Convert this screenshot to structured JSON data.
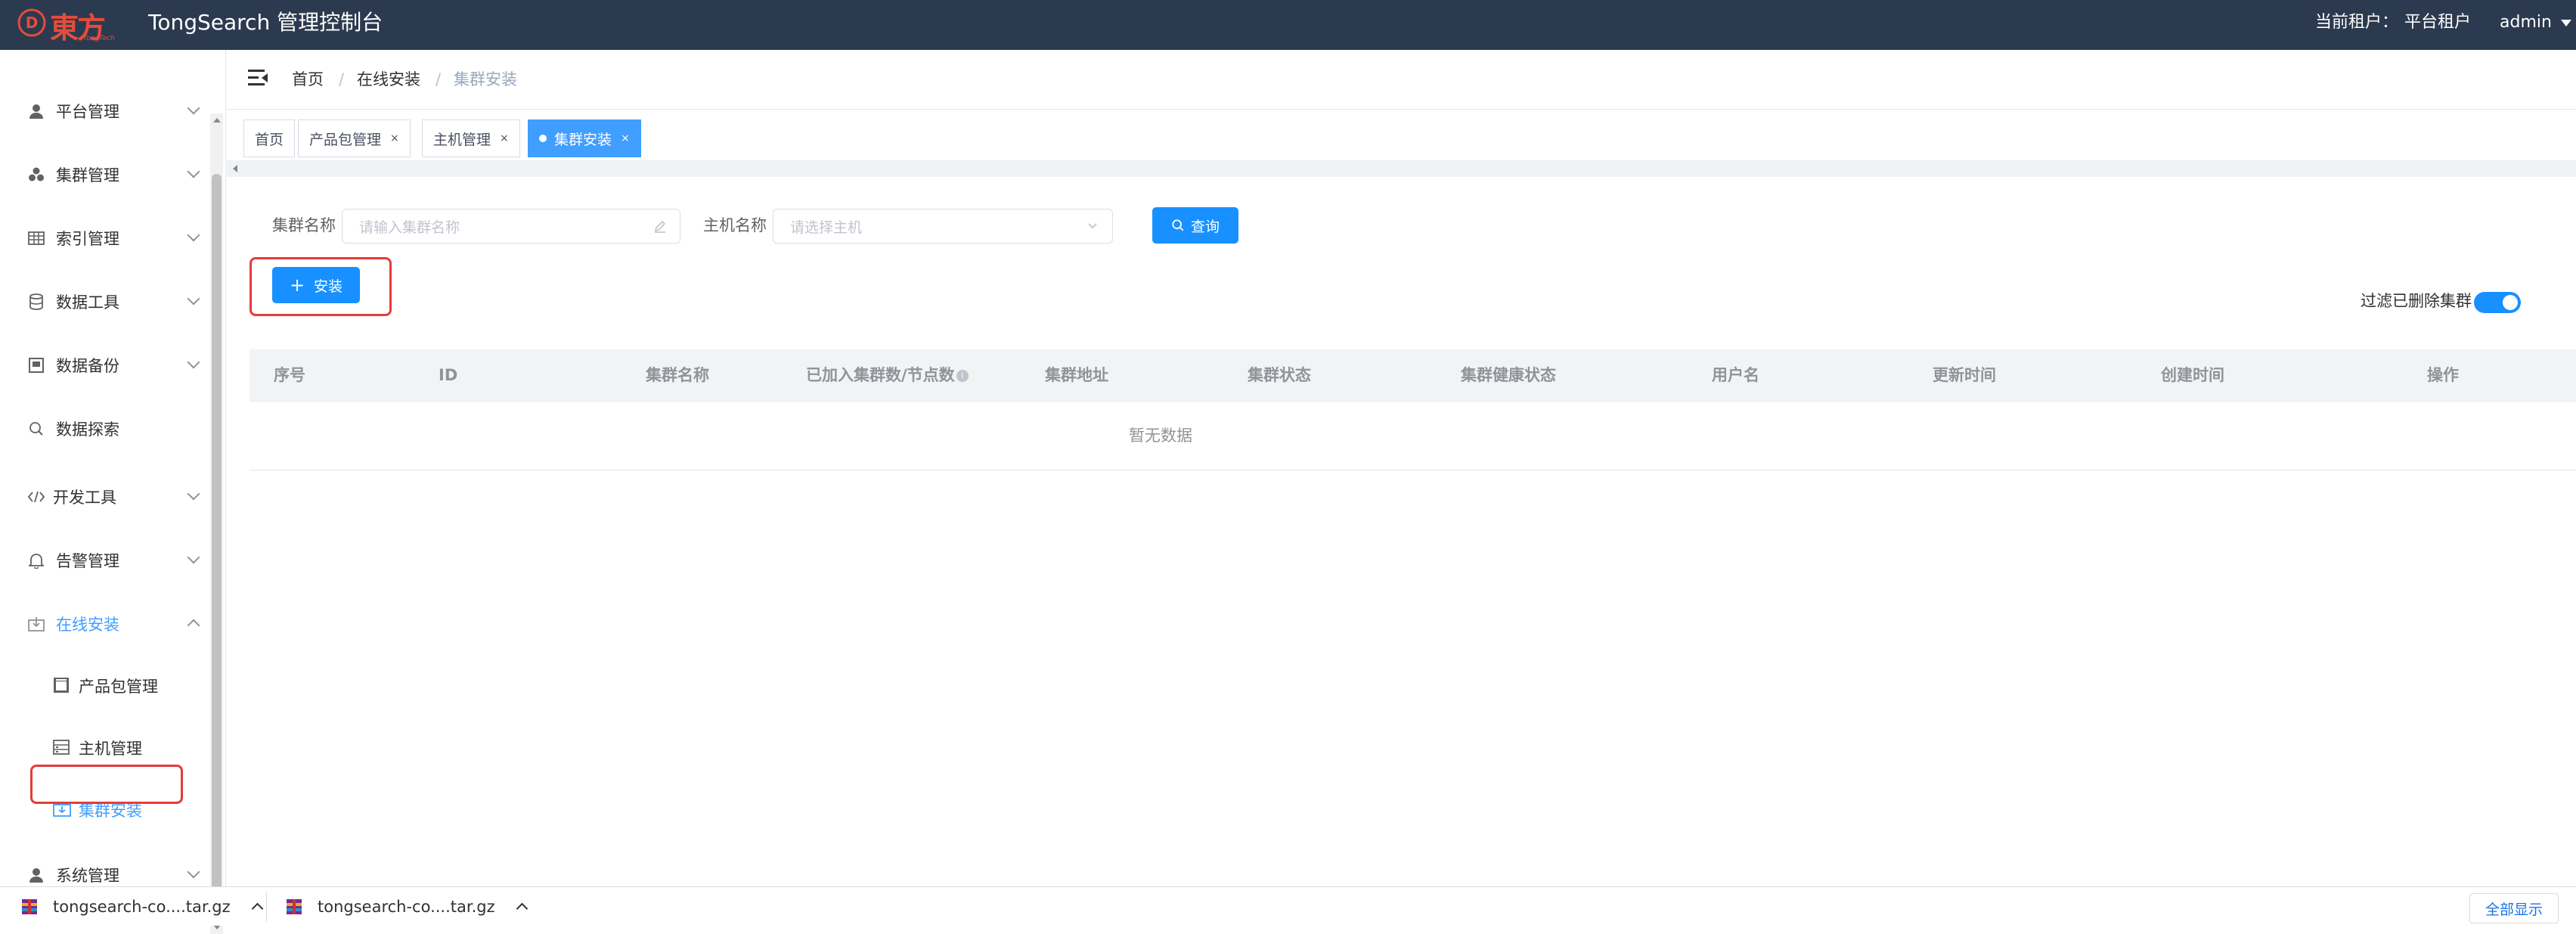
{
  "header": {
    "logo_text": "東方通",
    "logo_sub": "TongTech",
    "app_title": "TongSearch 管理控制台",
    "tenant_label": "当前租户：",
    "tenant_value": "平台租户",
    "user": "admin"
  },
  "sidebar": {
    "items": [
      {
        "label": "平台管理",
        "icon": "user-icon"
      },
      {
        "label": "集群管理",
        "icon": "cluster-icon"
      },
      {
        "label": "索引管理",
        "icon": "table-icon"
      },
      {
        "label": "数据工具",
        "icon": "database-icon"
      },
      {
        "label": "数据备份",
        "icon": "backup-icon"
      },
      {
        "label": "数据探索",
        "icon": "search-icon"
      },
      {
        "label": "开发工具",
        "icon": "code-icon"
      },
      {
        "label": "告警管理",
        "icon": "bell-icon"
      },
      {
        "label": "在线安装",
        "icon": "install-icon"
      },
      {
        "label": "系统管理",
        "icon": "user-icon"
      }
    ],
    "sub_items": [
      {
        "label": "产品包管理",
        "icon": "package-icon"
      },
      {
        "label": "主机管理",
        "icon": "server-icon"
      },
      {
        "label": "集群安装",
        "icon": "cluster-install-icon"
      }
    ],
    "active_color": "#409eff"
  },
  "breadcrumb": [
    "首页",
    "在线安装",
    "集群安装"
  ],
  "breadcrumb_sep": "/",
  "tabs": [
    {
      "label": "首页"
    },
    {
      "label": "产品包管理",
      "close": "×"
    },
    {
      "label": "主机管理",
      "close": "×"
    },
    {
      "label": "集群安装",
      "close": "×"
    }
  ],
  "search": {
    "cluster_name_label": "集群名称",
    "cluster_name_placeholder": "请输入集群名称",
    "host_name_label": "主机名称",
    "host_name_placeholder": "请选择主机",
    "query_button": "查询"
  },
  "install_button": "安装",
  "filter_deleted_label": "过滤已删除集群",
  "filter_deleted_on": true,
  "table": {
    "columns": [
      "序号",
      "ID",
      "集群名称",
      "已加入集群数/节点数",
      "集群地址",
      "集群状态",
      "集群健康状态",
      "用户名",
      "更新时间",
      "创建时间",
      "操作"
    ],
    "empty_text": "暂无数据"
  },
  "downloads": [
    {
      "name": "tongsearch-co....tar.gz"
    },
    {
      "name": "tongsearch-co....tar.gz"
    }
  ],
  "show_all": "全部显示",
  "colors": {
    "header_bg": "#2b3a4f",
    "primary": "#1890ff",
    "highlight": "#e63b3b"
  }
}
